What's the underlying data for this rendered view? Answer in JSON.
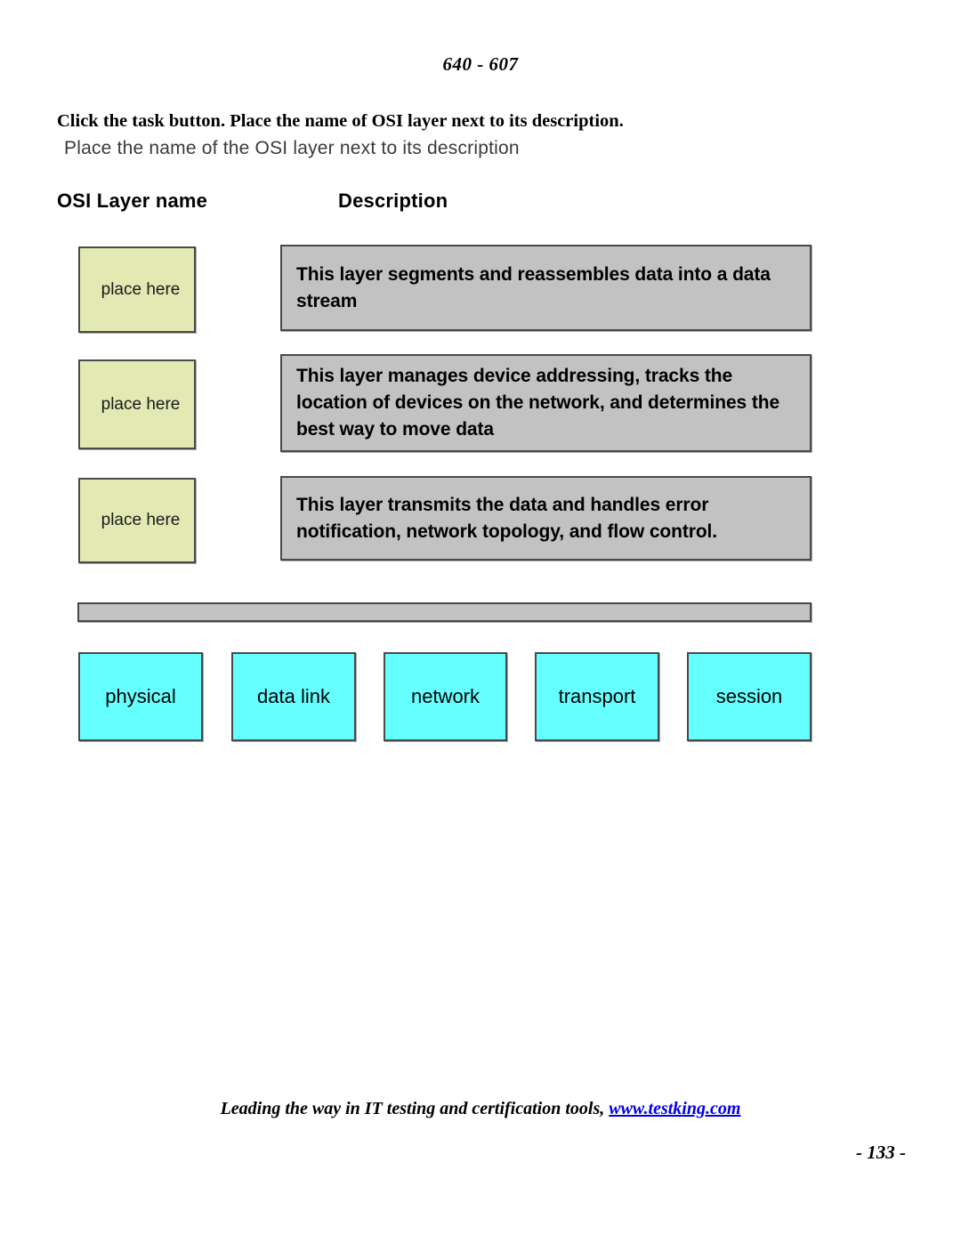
{
  "document": {
    "header": "640 - 607",
    "page_number": "- 133 -"
  },
  "question": {
    "instruction_bold": "Click the task button. Place the name of OSI layer next to its description",
    "instruction_tail": ".",
    "subtitle": "Place the name of the OSI layer next to its description"
  },
  "columns": {
    "layer_name_heading": "OSI Layer name",
    "description_heading": "Description"
  },
  "placeholders": [
    {
      "label": "place here"
    },
    {
      "label": "place here"
    },
    {
      "label": "place here"
    }
  ],
  "descriptions": [
    {
      "text": "This layer segments and reassembles data into a data stream"
    },
    {
      "text": "This layer manages device addressing, tracks the location of devices on the network, and determines the best way to move data"
    },
    {
      "text": "This layer transmits the data and handles error notification, network topology, and flow control."
    }
  ],
  "separator_bar": {
    "label": ""
  },
  "layer_options": [
    {
      "label": "physical"
    },
    {
      "label": "data link"
    },
    {
      "label": "network"
    },
    {
      "label": "transport"
    },
    {
      "label": "session"
    }
  ],
  "footer": {
    "text": "Leading the way in IT testing and certification tools, ",
    "site": "www.testking.com"
  },
  "colors": {
    "placeholder_fill": "#e3e9b2",
    "description_fill": "#c2c2c2",
    "layer_fill": "#66ffff",
    "box_border": "#4a4a4a",
    "link": "#0000ee"
  }
}
